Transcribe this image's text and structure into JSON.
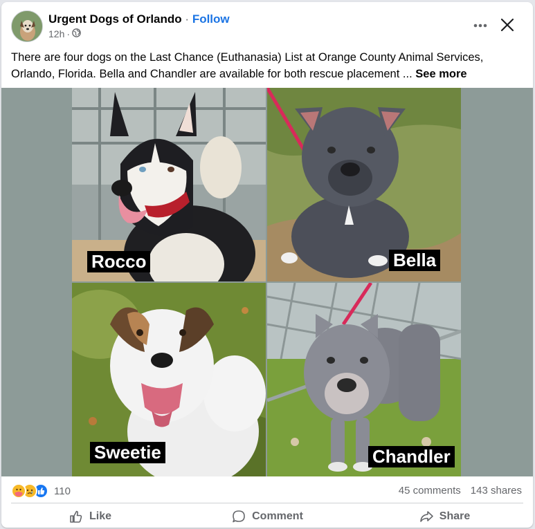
{
  "post": {
    "page_name": "Urgent Dogs of Orlando",
    "separator": "·",
    "follow_label": "Follow",
    "timestamp": "12h",
    "meta_separator": "·",
    "text": "There are four dogs on the Last Chance (Euthanasia) List at Orange County Animal Services, Orlando, Florida. Bella and Chandler are available for both rescue placement ...",
    "see_more_label": "See more"
  },
  "icons": {
    "audience": "globe-icon",
    "more": "more-options-icon",
    "close": "close-icon"
  },
  "photo": {
    "tiles": [
      {
        "name": "Rocco"
      },
      {
        "name": "Bella"
      },
      {
        "name": "Sweetie"
      },
      {
        "name": "Chandler"
      }
    ]
  },
  "engagement": {
    "reaction_types": [
      "care",
      "sad",
      "like"
    ],
    "reaction_count": "110",
    "comments": "45 comments",
    "shares": "143 shares"
  },
  "actions": {
    "like_label": "Like",
    "comment_label": "Comment",
    "share_label": "Share"
  },
  "colors": {
    "accent": "#1b74e4",
    "secondary_text": "#65676b",
    "like_blue": "#1877f2",
    "reaction_yellow": "#f7b928"
  }
}
